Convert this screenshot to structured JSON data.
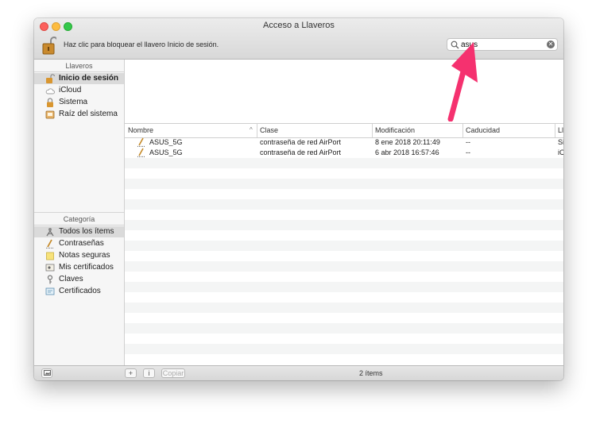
{
  "window": {
    "title": "Acceso a Llaveros"
  },
  "toolbar": {
    "lock_message": "Haz clic para bloquear el llavero Inicio de sesión.",
    "search_value": "asus"
  },
  "sidebar": {
    "keychains_header": "Llaveros",
    "keychains": [
      {
        "label": "Inicio de sesión",
        "icon": "unlocked-padlock-icon",
        "selected": true
      },
      {
        "label": "iCloud",
        "icon": "cloud-icon"
      },
      {
        "label": "Sistema",
        "icon": "padlock-icon"
      },
      {
        "label": "Raíz del sistema",
        "icon": "system-roots-icon"
      }
    ],
    "category_header": "Categoría",
    "categories": [
      {
        "label": "Todos los ítems",
        "icon": "all-items-icon",
        "selected": true
      },
      {
        "label": "Contraseñas",
        "icon": "password-pen-icon"
      },
      {
        "label": "Notas seguras",
        "icon": "secure-note-icon"
      },
      {
        "label": "Mis certificados",
        "icon": "my-certificates-icon"
      },
      {
        "label": "Claves",
        "icon": "key-icon"
      },
      {
        "label": "Certificados",
        "icon": "certificate-icon"
      }
    ]
  },
  "table": {
    "columns": [
      "Nombre",
      "Clase",
      "Modificación",
      "Caducidad",
      "Ll"
    ],
    "rows": [
      {
        "name": "ASUS_5G",
        "class": "contraseña de red AirPort",
        "modified": "8 ene 2018 20:11:49",
        "expires": "--",
        "keychain": "Si"
      },
      {
        "name": "ASUS_5G",
        "class": "contraseña de red AirPort",
        "modified": "6 abr 2018 16:57:46",
        "expires": "--",
        "keychain": "iC"
      }
    ]
  },
  "statusbar": {
    "add_label": "+",
    "info_label": "i",
    "copy_label": "Copiar",
    "count": "2 ítems"
  },
  "colors": {
    "annotation_arrow": "#f5316f",
    "selection": "#dadada"
  }
}
